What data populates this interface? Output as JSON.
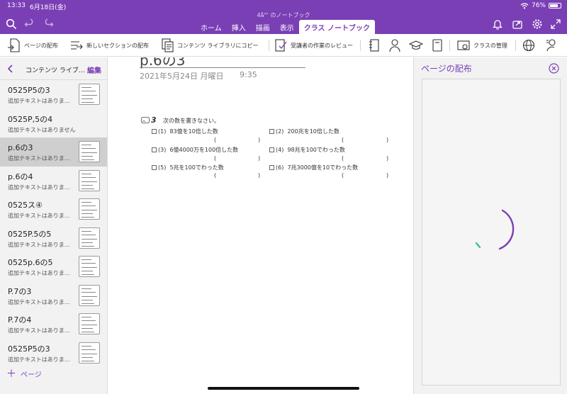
{
  "status": {
    "time": "13:33",
    "date": "6月18日(金)",
    "battery": "76%",
    "battery_level": 0.76
  },
  "notebook_title": "4å°‘ のノートブック",
  "header": {
    "tabs": [
      {
        "label": "ホーム",
        "active": false
      },
      {
        "label": "挿入",
        "active": false
      },
      {
        "label": "描画",
        "active": false
      },
      {
        "label": "表示",
        "active": false
      },
      {
        "label": "クラス ノートブック",
        "active": true
      }
    ]
  },
  "ribbon": {
    "distribute_page": "ページの配布",
    "distribute_section": "新しいセクションの配布",
    "copy_to_library": "コンテンツ ライブラリにコピー",
    "review_work": "受講者の作業のレビュー",
    "manage_class": "クラスの管理"
  },
  "sidebar": {
    "title": "コンテンツ ライブ…",
    "edit": "編集",
    "add_page": "ページ",
    "pages": [
      {
        "title": "0525P5の3",
        "subtitle": "追加テキストはありま…",
        "selected": false,
        "thumb": true
      },
      {
        "title": "0525P,5の4",
        "subtitle": "追加テキストはありません",
        "selected": false,
        "thumb": false
      },
      {
        "title": "p.6の3",
        "subtitle": "追加テキストはありま…",
        "selected": true,
        "thumb": true
      },
      {
        "title": "p.6の4",
        "subtitle": "追加テキストはありま…",
        "selected": false,
        "thumb": true
      },
      {
        "title": "0525ス④",
        "subtitle": "追加テキストはありま…",
        "selected": false,
        "thumb": true
      },
      {
        "title": "0525P.5の5",
        "subtitle": "追加テキストはありま…",
        "selected": false,
        "thumb": true
      },
      {
        "title": "0525p.6の5",
        "subtitle": "追加テキストはありま…",
        "selected": false,
        "thumb": true
      },
      {
        "title": "P.7の3",
        "subtitle": "追加テキストはありま…",
        "selected": false,
        "thumb": true
      },
      {
        "title": "P.7の4",
        "subtitle": "追加テキストはありま…",
        "selected": false,
        "thumb": true
      },
      {
        "title": "0525P5の3",
        "subtitle": "追加テキストはありま…",
        "selected": false,
        "thumb": true
      }
    ]
  },
  "page": {
    "title": "p.6の3",
    "date": "2021年5月24日 月曜日",
    "time": "9:35",
    "problem_number": "3",
    "instruction": "次の数を書きなさい。",
    "questions": [
      {
        "num": "(1)",
        "text": "83億を10倍した数"
      },
      {
        "num": "(2)",
        "text": "200兆を10倍した数"
      },
      {
        "num": "(3)",
        "text": "6億4000万を100倍した数"
      },
      {
        "num": "(4)",
        "text": "98兆を100でわった数"
      },
      {
        "num": "(5)",
        "text": "5兆を100でわった数"
      },
      {
        "num": "(6)",
        "text": "7兆3000億を10でわった数"
      }
    ],
    "answer_paren_open": "(",
    "answer_paren_close": ")"
  },
  "panel": {
    "title": "ページの配布"
  },
  "colors": {
    "accent": "#7a3fb5",
    "spinner_tail": "#3dbf9a"
  }
}
